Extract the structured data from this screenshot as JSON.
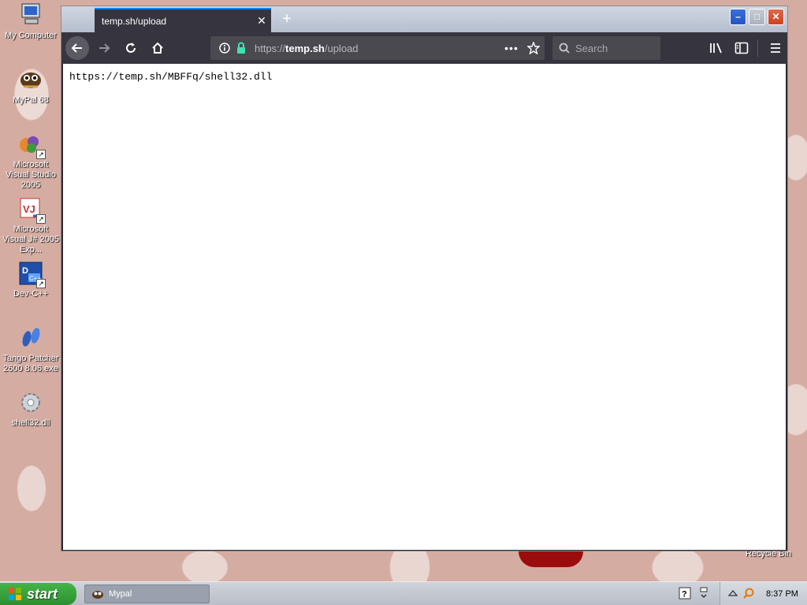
{
  "desktop": {
    "icons": [
      {
        "label": "My Computer"
      },
      {
        "label": "MyPal 68"
      },
      {
        "label": "Microsoft Visual Studio 2005"
      },
      {
        "label": "Microsoft Visual J# 2005 Exp..."
      },
      {
        "label": "Dev-C++"
      },
      {
        "label": "Tango Patcher 2600 8.06.exe"
      },
      {
        "label": "shell32.dll"
      }
    ],
    "recycle_label": "Recycle Bin"
  },
  "browser": {
    "tab_title": "temp.sh/upload",
    "url_prefix": "https://",
    "url_host": "temp.sh",
    "url_path": "/upload",
    "search_placeholder": "Search",
    "page_text": "https://temp.sh/MBFFq/shell32.dll",
    "accent_color": "#0a84ff",
    "lock_color": "#3fe1b0"
  },
  "taskbar": {
    "start_label": "start",
    "task_items": [
      {
        "label": "Mypal"
      }
    ],
    "clock": "8:37 PM"
  }
}
